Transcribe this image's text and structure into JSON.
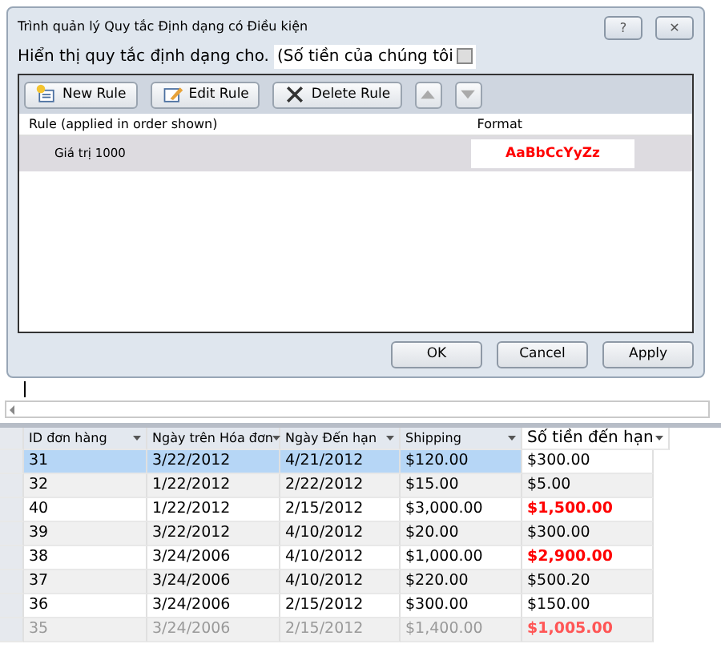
{
  "dialog": {
    "title": "Trình quản lý Quy tắc Định dạng có Điều kiện",
    "help_button": "?",
    "close_button": "✕",
    "show_label": "Hiển thị quy tắc định dạng cho.",
    "field_value": "(Số tiền của chúng tôi",
    "toolbar": [
      {
        "label": "New Rule",
        "kind": "new"
      },
      {
        "label": "Edit Rule",
        "kind": "edit"
      },
      {
        "label": "Delete Rule",
        "kind": "delete"
      },
      {
        "kind": "up"
      },
      {
        "kind": "down"
      }
    ],
    "columns": [
      "Rule (applied in order shown)",
      "Format"
    ],
    "rules": [
      {
        "rule": "Giá trị 1000",
        "format": "AaBbCcYyZz",
        "selected": true
      }
    ],
    "buttons": [
      "OK",
      "Cancel",
      "Apply"
    ]
  },
  "datasheet": {
    "columns": [
      "ID đơn hàng",
      "Ngày trên Hóa đơn",
      "Ngày Đến hạn",
      "Shipping",
      "Số tiền đến hạn"
    ],
    "rows": [
      {
        "cells": [
          "31",
          "3/22/2012",
          "4/21/2012",
          "$120.00",
          "$300.00"
        ],
        "selected": true,
        "flagged": false
      },
      {
        "cells": [
          "32",
          "1/22/2012",
          "2/22/2012",
          "$15.00",
          "$5.00"
        ],
        "selected": false,
        "flagged": false
      },
      {
        "cells": [
          "40",
          "1/22/2012",
          "2/15/2012",
          "$3,000.00",
          "$1,500.00"
        ],
        "selected": false,
        "flagged": true
      },
      {
        "cells": [
          "39",
          "3/22/2012",
          "4/10/2012",
          "$20.00",
          "$300.00"
        ],
        "selected": false,
        "flagged": false
      },
      {
        "cells": [
          "38",
          "3/24/2006",
          "4/10/2012",
          "$1,000.00",
          "$2,900.00"
        ],
        "selected": false,
        "flagged": true
      },
      {
        "cells": [
          "37",
          "3/24/2006",
          "4/10/2012",
          "$220.00",
          "$500.20"
        ],
        "selected": false,
        "flagged": false
      },
      {
        "cells": [
          "36",
          "3/24/2006",
          "2/15/2012",
          "$300.00",
          "$150.00"
        ],
        "selected": false,
        "flagged": false
      },
      {
        "cells": [
          "35",
          "3/24/2006",
          "2/15/2012",
          "$1,400.00",
          "$1,005.00"
        ],
        "selected": false,
        "flagged": true
      }
    ]
  }
}
